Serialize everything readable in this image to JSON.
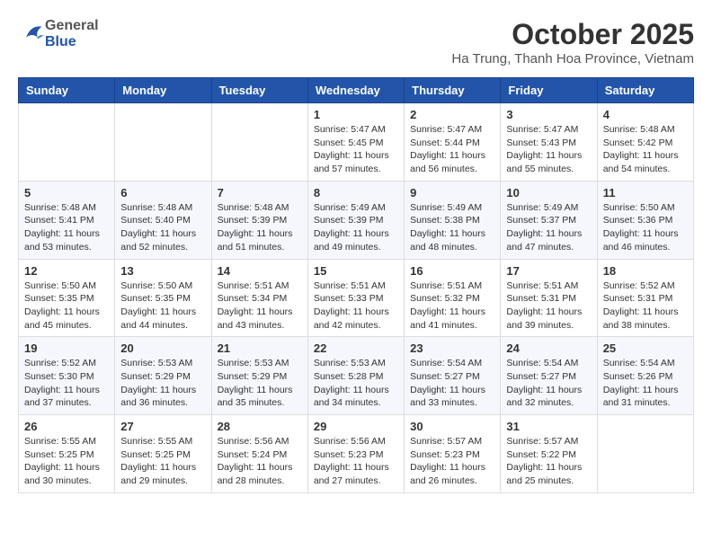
{
  "logo": {
    "general": "General",
    "blue": "Blue"
  },
  "title": "October 2025",
  "subtitle": "Ha Trung, Thanh Hoa Province, Vietnam",
  "days_of_week": [
    "Sunday",
    "Monday",
    "Tuesday",
    "Wednesday",
    "Thursday",
    "Friday",
    "Saturday"
  ],
  "weeks": [
    [
      {
        "day": "",
        "info": ""
      },
      {
        "day": "",
        "info": ""
      },
      {
        "day": "",
        "info": ""
      },
      {
        "day": "1",
        "info": "Sunrise: 5:47 AM\nSunset: 5:45 PM\nDaylight: 11 hours and 57 minutes."
      },
      {
        "day": "2",
        "info": "Sunrise: 5:47 AM\nSunset: 5:44 PM\nDaylight: 11 hours and 56 minutes."
      },
      {
        "day": "3",
        "info": "Sunrise: 5:47 AM\nSunset: 5:43 PM\nDaylight: 11 hours and 55 minutes."
      },
      {
        "day": "4",
        "info": "Sunrise: 5:48 AM\nSunset: 5:42 PM\nDaylight: 11 hours and 54 minutes."
      }
    ],
    [
      {
        "day": "5",
        "info": "Sunrise: 5:48 AM\nSunset: 5:41 PM\nDaylight: 11 hours and 53 minutes."
      },
      {
        "day": "6",
        "info": "Sunrise: 5:48 AM\nSunset: 5:40 PM\nDaylight: 11 hours and 52 minutes."
      },
      {
        "day": "7",
        "info": "Sunrise: 5:48 AM\nSunset: 5:39 PM\nDaylight: 11 hours and 51 minutes."
      },
      {
        "day": "8",
        "info": "Sunrise: 5:49 AM\nSunset: 5:39 PM\nDaylight: 11 hours and 49 minutes."
      },
      {
        "day": "9",
        "info": "Sunrise: 5:49 AM\nSunset: 5:38 PM\nDaylight: 11 hours and 48 minutes."
      },
      {
        "day": "10",
        "info": "Sunrise: 5:49 AM\nSunset: 5:37 PM\nDaylight: 11 hours and 47 minutes."
      },
      {
        "day": "11",
        "info": "Sunrise: 5:50 AM\nSunset: 5:36 PM\nDaylight: 11 hours and 46 minutes."
      }
    ],
    [
      {
        "day": "12",
        "info": "Sunrise: 5:50 AM\nSunset: 5:35 PM\nDaylight: 11 hours and 45 minutes."
      },
      {
        "day": "13",
        "info": "Sunrise: 5:50 AM\nSunset: 5:35 PM\nDaylight: 11 hours and 44 minutes."
      },
      {
        "day": "14",
        "info": "Sunrise: 5:51 AM\nSunset: 5:34 PM\nDaylight: 11 hours and 43 minutes."
      },
      {
        "day": "15",
        "info": "Sunrise: 5:51 AM\nSunset: 5:33 PM\nDaylight: 11 hours and 42 minutes."
      },
      {
        "day": "16",
        "info": "Sunrise: 5:51 AM\nSunset: 5:32 PM\nDaylight: 11 hours and 41 minutes."
      },
      {
        "day": "17",
        "info": "Sunrise: 5:51 AM\nSunset: 5:31 PM\nDaylight: 11 hours and 39 minutes."
      },
      {
        "day": "18",
        "info": "Sunrise: 5:52 AM\nSunset: 5:31 PM\nDaylight: 11 hours and 38 minutes."
      }
    ],
    [
      {
        "day": "19",
        "info": "Sunrise: 5:52 AM\nSunset: 5:30 PM\nDaylight: 11 hours and 37 minutes."
      },
      {
        "day": "20",
        "info": "Sunrise: 5:53 AM\nSunset: 5:29 PM\nDaylight: 11 hours and 36 minutes."
      },
      {
        "day": "21",
        "info": "Sunrise: 5:53 AM\nSunset: 5:29 PM\nDaylight: 11 hours and 35 minutes."
      },
      {
        "day": "22",
        "info": "Sunrise: 5:53 AM\nSunset: 5:28 PM\nDaylight: 11 hours and 34 minutes."
      },
      {
        "day": "23",
        "info": "Sunrise: 5:54 AM\nSunset: 5:27 PM\nDaylight: 11 hours and 33 minutes."
      },
      {
        "day": "24",
        "info": "Sunrise: 5:54 AM\nSunset: 5:27 PM\nDaylight: 11 hours and 32 minutes."
      },
      {
        "day": "25",
        "info": "Sunrise: 5:54 AM\nSunset: 5:26 PM\nDaylight: 11 hours and 31 minutes."
      }
    ],
    [
      {
        "day": "26",
        "info": "Sunrise: 5:55 AM\nSunset: 5:25 PM\nDaylight: 11 hours and 30 minutes."
      },
      {
        "day": "27",
        "info": "Sunrise: 5:55 AM\nSunset: 5:25 PM\nDaylight: 11 hours and 29 minutes."
      },
      {
        "day": "28",
        "info": "Sunrise: 5:56 AM\nSunset: 5:24 PM\nDaylight: 11 hours and 28 minutes."
      },
      {
        "day": "29",
        "info": "Sunrise: 5:56 AM\nSunset: 5:23 PM\nDaylight: 11 hours and 27 minutes."
      },
      {
        "day": "30",
        "info": "Sunrise: 5:57 AM\nSunset: 5:23 PM\nDaylight: 11 hours and 26 minutes."
      },
      {
        "day": "31",
        "info": "Sunrise: 5:57 AM\nSunset: 5:22 PM\nDaylight: 11 hours and 25 minutes."
      },
      {
        "day": "",
        "info": ""
      }
    ]
  ]
}
